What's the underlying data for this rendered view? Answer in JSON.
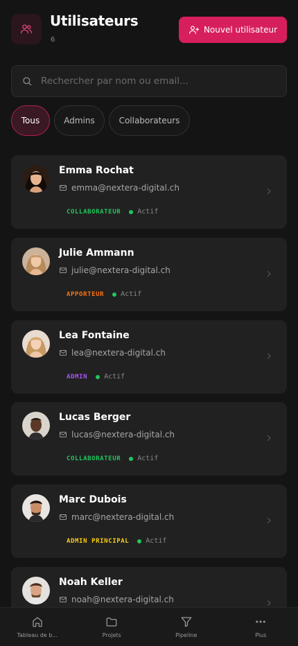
{
  "header": {
    "title": "Utilisateurs",
    "count": "6",
    "new_button_label": "Nouvel utilisateur"
  },
  "search": {
    "placeholder": "Rechercher par nom ou email..."
  },
  "filters": [
    {
      "label": "Tous",
      "active": true
    },
    {
      "label": "Admins",
      "active": false
    },
    {
      "label": "Collaborateurs",
      "active": false
    }
  ],
  "users": [
    {
      "name": "Emma Rochat",
      "email": "emma@nextera-digital.ch",
      "role": "COLLABORATEUR",
      "role_color": "#22c55e",
      "status": "Actif"
    },
    {
      "name": "Julie Ammann",
      "email": "julie@nextera-digital.ch",
      "role": "APPORTEUR",
      "role_color": "#f97316",
      "status": "Actif"
    },
    {
      "name": "Lea Fontaine",
      "email": "lea@nextera-digital.ch",
      "role": "ADMIN",
      "role_color": "#a855f7",
      "status": "Actif"
    },
    {
      "name": "Lucas Berger",
      "email": "lucas@nextera-digital.ch",
      "role": "COLLABORATEUR",
      "role_color": "#22c55e",
      "status": "Actif"
    },
    {
      "name": "Marc Dubois",
      "email": "marc@nextera-digital.ch",
      "role": "ADMIN PRINCIPAL",
      "role_color": "#facc15",
      "status": "Actif"
    },
    {
      "name": "Noah Keller",
      "email": "noah@nextera-digital.ch",
      "role": "",
      "role_color": "#22c55e",
      "status": ""
    }
  ],
  "bottom_nav": [
    {
      "label": "Tableau de b...",
      "icon": "home-icon"
    },
    {
      "label": "Projets",
      "icon": "folder-icon"
    },
    {
      "label": "Pipeline",
      "icon": "funnel-icon"
    },
    {
      "label": "Plus",
      "icon": "more-icon"
    }
  ],
  "colors": {
    "accent": "#d61f5c",
    "background": "#141414",
    "card": "#212121",
    "status_active": "#22c55e"
  }
}
